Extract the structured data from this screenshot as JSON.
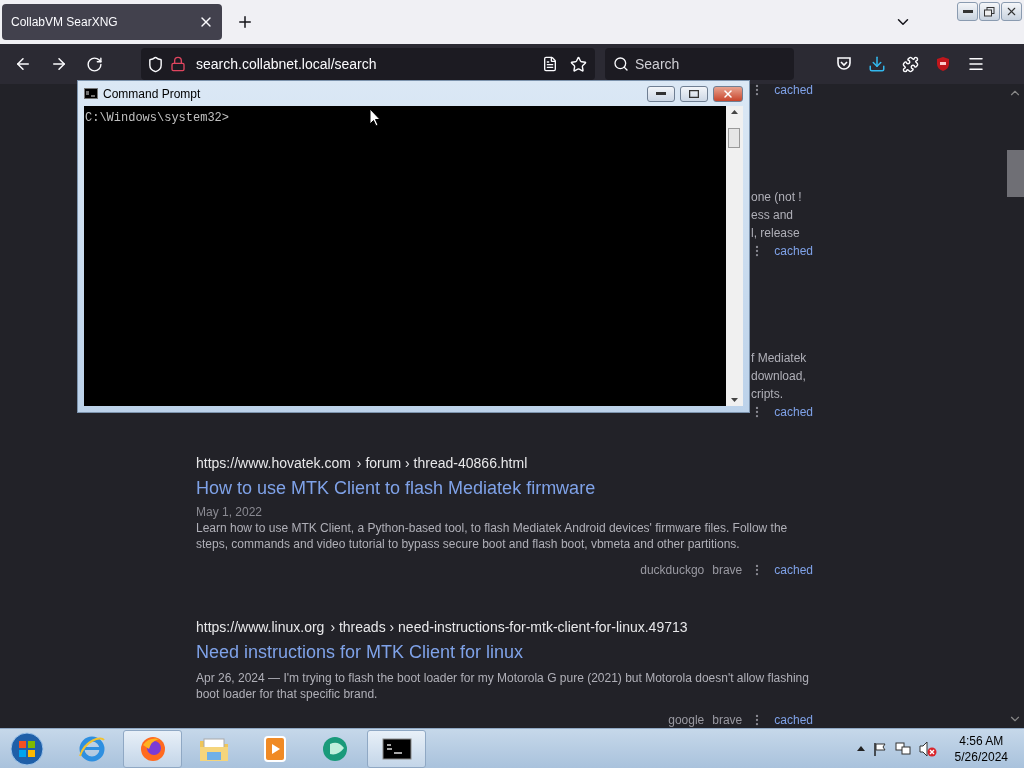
{
  "browser": {
    "tab": {
      "title": "CollabVM SearXNG",
      "selected": true
    },
    "url": "search.collabnet.local/search",
    "search_placeholder": "Search"
  },
  "covered_results": [
    {
      "cached": "cached"
    },
    {
      "lines": [
        "one (not !",
        "ess and",
        "l, release"
      ],
      "cached": "cached"
    },
    {
      "lines": [
        "f Mediatek",
        "download,",
        "cripts."
      ],
      "cached": "cached"
    }
  ],
  "results": [
    {
      "url": "https://www.hovatek.com",
      "path": "› forum › thread-40866.html",
      "title": "How to use MTK Client to flash Mediatek firmware",
      "date": "May 1, 2022",
      "snippet": "Learn how to use MTK Client, a Python-based tool, to flash Mediatek Android devices' firmware files. Follow the steps, commands and video tutorial to bypass secure boot and flash boot, vbmeta and other partitions.",
      "engines": [
        "duckduckgo",
        "brave"
      ],
      "cached": "cached"
    },
    {
      "url": "https://www.linux.org",
      "path": "› threads › need-instructions-for-mtk-client-for-linux.49713",
      "title": "Need instructions for MTK Client for linux",
      "snippet": "Apr 26, 2024 — I'm trying to flash the boot loader for my Motorola G pure (2021) but Motorola doesn't allow flashing boot loader for that specific brand.",
      "engines": [
        "google",
        "brave"
      ],
      "cached": "cached"
    }
  ],
  "cmd": {
    "title": "Command Prompt",
    "prompt": "C:\\Windows\\system32>"
  },
  "taskbar": {
    "apps": [
      {
        "kind": "ie",
        "running": false
      },
      {
        "kind": "firefox",
        "running": true
      },
      {
        "kind": "explorer",
        "running": false
      },
      {
        "kind": "media",
        "running": false
      },
      {
        "kind": "green",
        "running": false
      },
      {
        "kind": "cmd",
        "running": true
      }
    ],
    "time": "4:56 AM",
    "date": "5/26/2024"
  }
}
